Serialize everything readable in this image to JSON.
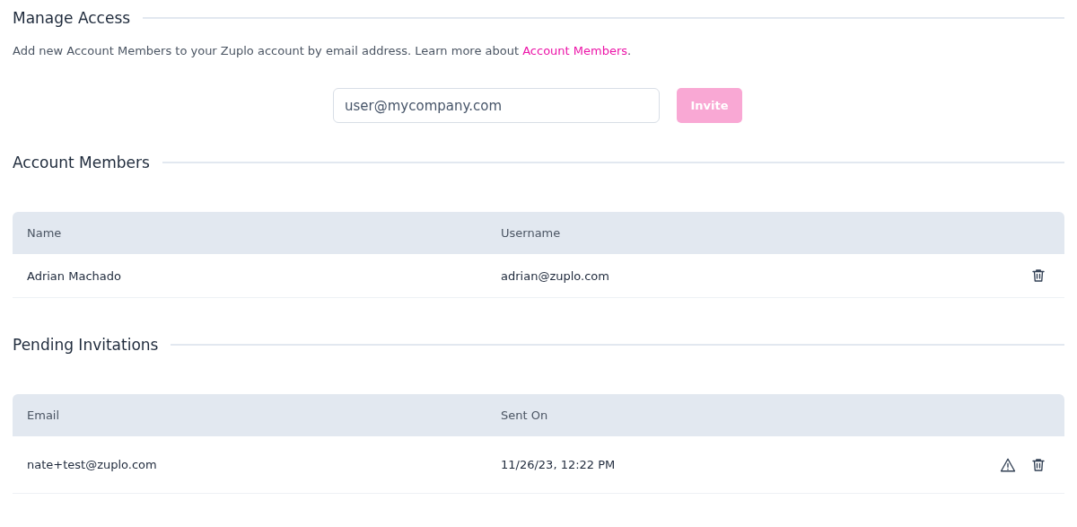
{
  "manage_access": {
    "title": "Manage Access",
    "description": "Add new Account Members to your Zuplo account by email address. Learn more about ",
    "link": "Account Members",
    "after_link": ".",
    "email_field": {
      "placeholder": "user@mycompany.com"
    },
    "invite_button": {
      "label": "Invite",
      "disabled": true
    }
  },
  "account_members": {
    "title": "Account Members",
    "columns": [
      "Name",
      "Username"
    ],
    "rows": [
      {
        "cells": [
          "Adrian Machado",
          "adrian@zuplo.com"
        ],
        "actions": [
          {
            "kind": "delete"
          }
        ]
      }
    ]
  },
  "pending_invitations": {
    "title": "Pending Invitations",
    "columns": [
      "Email",
      "Sent On"
    ],
    "rows": [
      {
        "cells": [
          "nate+test@zuplo.com",
          "11/26/23, 12:22 PM"
        ],
        "actions": [
          {
            "kind": "warning"
          },
          {
            "kind": "delete"
          }
        ]
      }
    ]
  }
}
